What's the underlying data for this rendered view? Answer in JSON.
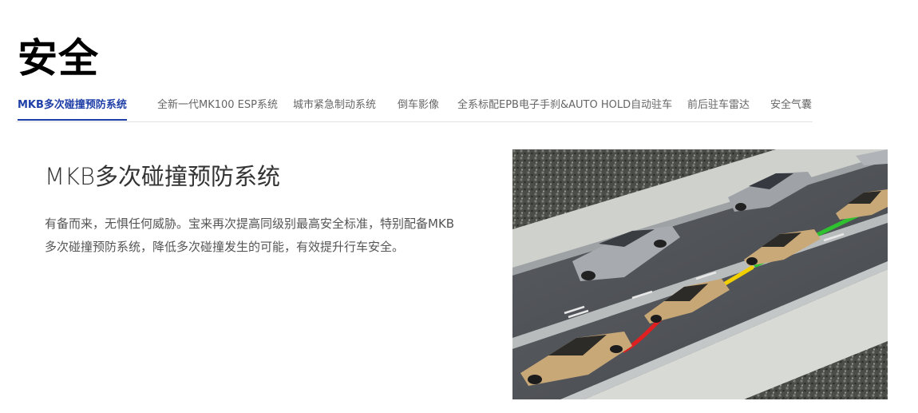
{
  "page": {
    "title": "安全"
  },
  "tabs": [
    {
      "label": "MKB多次碰撞预防系统",
      "active": true
    },
    {
      "label": "全新一代MK100 ESP系统",
      "active": false
    },
    {
      "label": "城市紧急制动系统",
      "active": false
    },
    {
      "label": "倒车影像",
      "active": false
    },
    {
      "label": "全系标配EPB电子手刹&AUTO HOLD自动驻车",
      "active": false
    },
    {
      "label": "前后驻车雷达",
      "active": false
    },
    {
      "label": "安全气囊",
      "active": false
    }
  ],
  "feature": {
    "title": "MKB多次碰撞预防系统",
    "description": "有备而来，无惧任何威胁。宝来再次提高同级别最高安全标准，特别配备MKB多次碰撞预防系统，降低多次碰撞发生的可能，有效提升行车安全。"
  },
  "colors": {
    "accent": "#1f3fa8",
    "tab_text": "#666666",
    "trajectory_red": "#e02020",
    "trajectory_yellow": "#f2d000",
    "trajectory_green": "#2fc22f"
  }
}
